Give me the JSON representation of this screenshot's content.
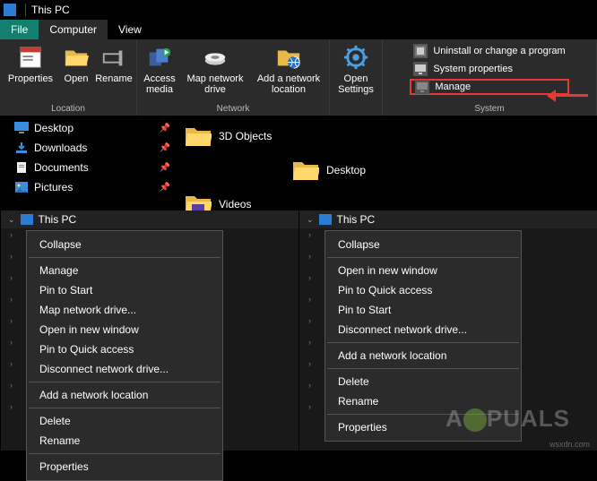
{
  "titlebar": {
    "title": "This PC"
  },
  "tabs": {
    "file": "File",
    "computer": "Computer",
    "view": "View"
  },
  "ribbon": {
    "location": {
      "label": "Location",
      "properties": "Properties",
      "open": "Open",
      "rename": "Rename"
    },
    "network": {
      "label": "Network",
      "access_media": "Access media",
      "map_drive": "Map network drive",
      "add_location": "Add a network location"
    },
    "settings": {
      "open_settings": "Open Settings"
    },
    "system": {
      "label": "System",
      "uninstall": "Uninstall or change a program",
      "properties": "System properties",
      "manage": "Manage"
    }
  },
  "nav": {
    "items": [
      {
        "label": "Desktop"
      },
      {
        "label": "Downloads"
      },
      {
        "label": "Documents"
      },
      {
        "label": "Pictures"
      }
    ]
  },
  "folders": {
    "a": "3D Objects",
    "b": "Videos",
    "c": "Desktop"
  },
  "tree": {
    "this_pc": "This PC"
  },
  "ctx_left": {
    "collapse": "Collapse",
    "manage": "Manage",
    "pin_start": "Pin to Start",
    "map_drive": "Map network drive...",
    "open_new": "Open in new window",
    "pin_quick": "Pin to Quick access",
    "disconnect": "Disconnect network drive...",
    "add_loc": "Add a network location",
    "delete": "Delete",
    "rename": "Rename",
    "properties": "Properties"
  },
  "ctx_right": {
    "collapse": "Collapse",
    "open_new": "Open in new window",
    "pin_quick": "Pin to Quick access",
    "pin_start": "Pin to Start",
    "disconnect": "Disconnect network drive...",
    "add_loc": "Add a network location",
    "delete": "Delete",
    "rename": "Rename",
    "properties": "Properties"
  },
  "watermark": {
    "text_a": "A",
    "text_b": "PUALS"
  },
  "footer": {
    "url": "wsxdn.com"
  }
}
